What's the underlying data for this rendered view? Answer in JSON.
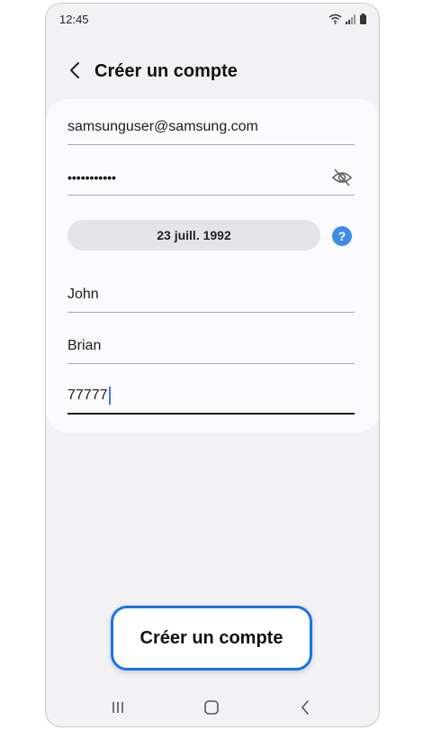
{
  "status_bar": {
    "time": "12:45",
    "icons": [
      "wifi-icon",
      "signal-icon",
      "battery-icon"
    ]
  },
  "header": {
    "back_icon": "chevron-left-icon",
    "title": "Créer un compte"
  },
  "form": {
    "email": {
      "value": "samsunguser@samsung.com"
    },
    "password": {
      "masked_value": "•••••••••••",
      "visibility_icon": "eye-off-icon"
    },
    "birth_date": {
      "value": "23 juill. 1992",
      "help_icon": "question-mark-icon"
    },
    "first_name": {
      "value": "John"
    },
    "last_name": {
      "value": "Brian"
    },
    "zip_code": {
      "value": "77777"
    }
  },
  "actions": {
    "create_account_label": "Créer un compte"
  },
  "nav_bar": {
    "icons": [
      "recents-icon",
      "home-icon",
      "back-icon"
    ]
  },
  "colors": {
    "accent": "#1a73e8",
    "help": "#3f8ce8",
    "background": "#f2f2f5",
    "card": "#fbfbfd"
  }
}
